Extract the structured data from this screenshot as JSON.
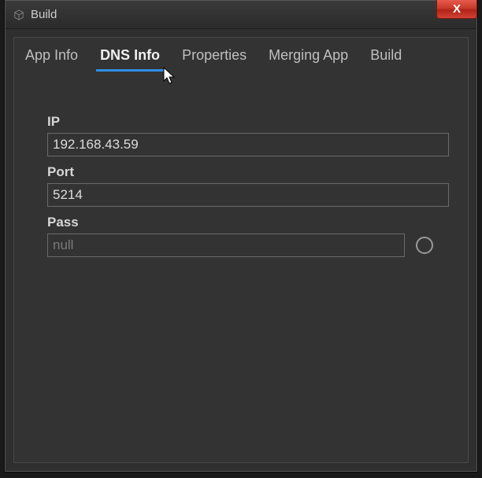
{
  "window": {
    "title": "Build"
  },
  "tabs": {
    "items": [
      {
        "label": "App Info"
      },
      {
        "label": "DNS Info"
      },
      {
        "label": "Properties"
      },
      {
        "label": "Merging App"
      },
      {
        "label": "Build"
      }
    ],
    "active_index": 1
  },
  "form": {
    "ip": {
      "label": "IP",
      "value": "192.168.43.59"
    },
    "port": {
      "label": "Port",
      "value": "5214"
    },
    "pass": {
      "label": "Pass",
      "placeholder": "null",
      "value": ""
    }
  },
  "icons": {
    "app_icon": "cube",
    "close": "X",
    "pass_action": "circle"
  }
}
